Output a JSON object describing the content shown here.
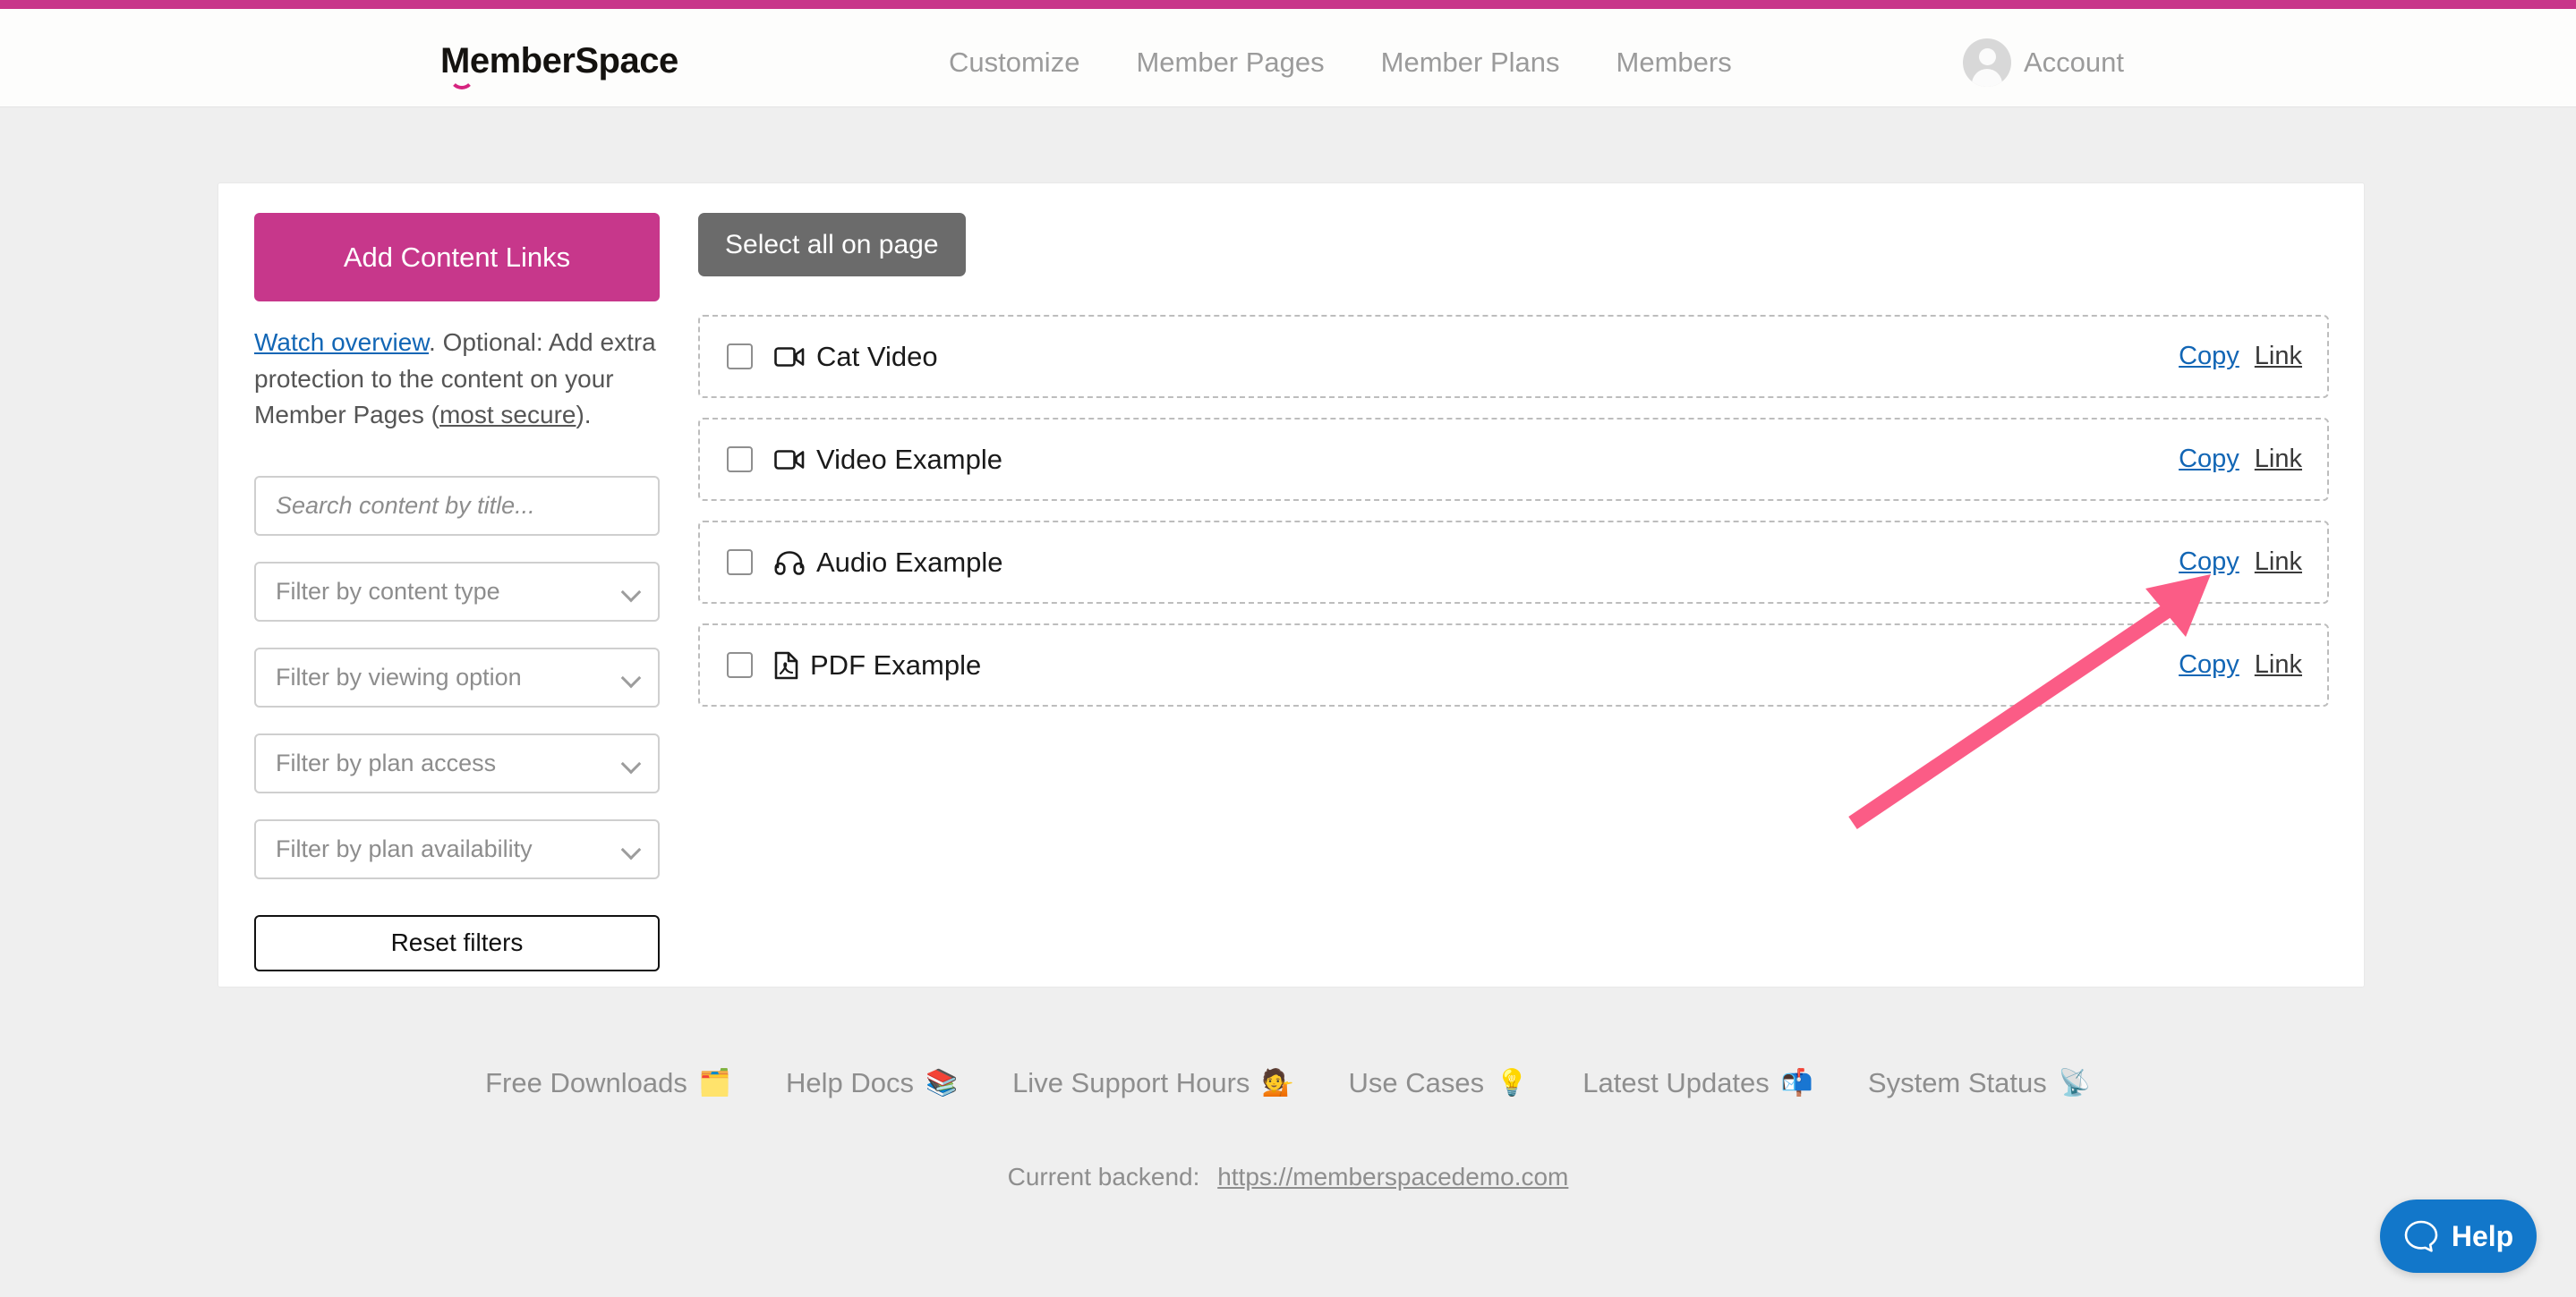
{
  "header": {
    "logo_text": "MemberSpace",
    "nav": [
      {
        "label": "Customize"
      },
      {
        "label": "Member Pages"
      },
      {
        "label": "Member Plans"
      },
      {
        "label": "Members"
      }
    ],
    "account_label": "Account",
    "avatar_icon": "user-avatar-icon"
  },
  "sidebar": {
    "add_button_label": "Add Content Links",
    "helper": {
      "watch_link": "Watch overview",
      "middle": ". Optional: Add extra protection to the content on your Member Pages (",
      "secure_link": "most secure",
      "tail": ")."
    },
    "search": {
      "placeholder": "Search content by title...",
      "value": ""
    },
    "filters": [
      {
        "label": "Filter by content type",
        "icon": "chevron-down-icon"
      },
      {
        "label": "Filter by viewing option",
        "icon": "chevron-down-icon"
      },
      {
        "label": "Filter by plan access",
        "icon": "chevron-down-icon"
      },
      {
        "label": "Filter by plan availability",
        "icon": "chevron-down-icon"
      }
    ],
    "reset_label": "Reset filters"
  },
  "content": {
    "select_all_label": "Select all on page",
    "copy_label": "Copy",
    "link_label": "Link",
    "rows": [
      {
        "title": "Cat Video",
        "icon": "video-camera-icon",
        "checked": false
      },
      {
        "title": "Video Example",
        "icon": "video-camera-icon",
        "checked": false
      },
      {
        "title": "Audio Example",
        "icon": "headphones-icon",
        "checked": false
      },
      {
        "title": "PDF Example",
        "icon": "file-pdf-icon",
        "checked": false
      }
    ]
  },
  "annotation": {
    "arrow_color": "#fb5c86",
    "points_to": "Copy link on Audio Example row"
  },
  "footer": {
    "links": [
      {
        "label": "Free Downloads",
        "emoji": "🗂️"
      },
      {
        "label": "Help Docs",
        "emoji": "📚"
      },
      {
        "label": "Live Support Hours",
        "emoji": "💁"
      },
      {
        "label": "Use Cases",
        "emoji": "💡"
      },
      {
        "label": "Latest Updates",
        "emoji": "📬"
      },
      {
        "label": "System Status",
        "emoji": "📡"
      }
    ],
    "backend_label": "Current backend:",
    "backend_url": "https://memberspacedemo.com"
  },
  "help_widget": {
    "label": "Help",
    "icon": "speech-bubble-icon",
    "color": "#1277ca"
  },
  "colors": {
    "brand_pink": "#c8368a",
    "link_blue": "#1266b5",
    "page_bg": "#efefef"
  }
}
